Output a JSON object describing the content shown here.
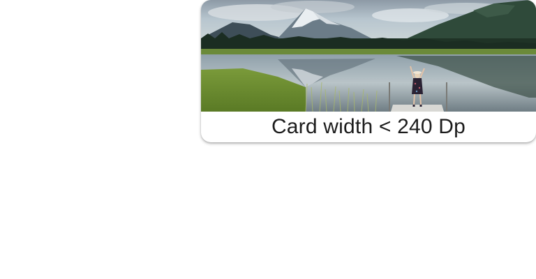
{
  "card": {
    "image_subject": "mountain lake landscape with person on dock",
    "caption": "Card width < 240 Dp"
  }
}
